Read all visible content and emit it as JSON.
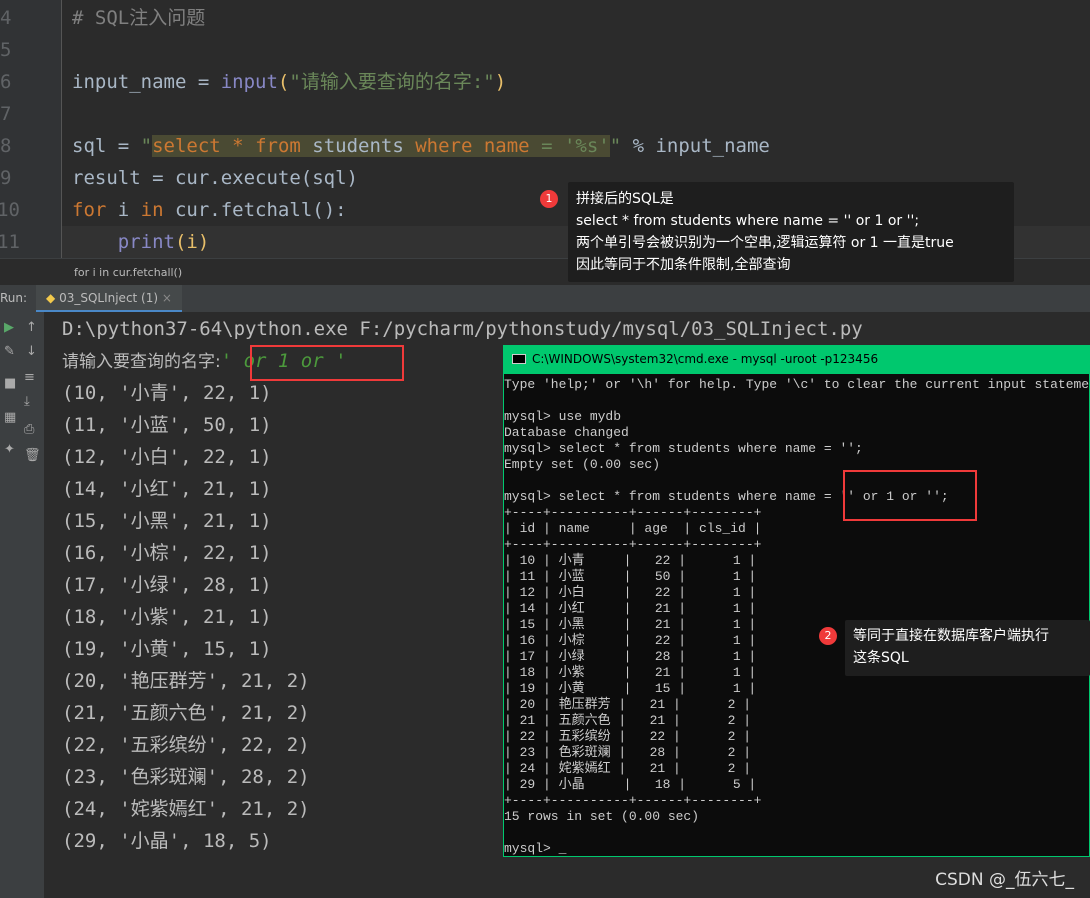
{
  "editor": {
    "line_numbers": [
      "4",
      "5",
      "6",
      "7",
      "8",
      "9",
      "10",
      "11"
    ],
    "comment": "# SQL注入问题",
    "l6": {
      "a": "input_name = ",
      "fn": "input",
      "p1": "(",
      "str": "\"请输入要查询的名字:\"",
      "p2": ")"
    },
    "l8": {
      "a": "sql = ",
      "q": "\"",
      "s1": "select",
      "s2": " * ",
      "s3": "from",
      "s4": " students ",
      "s5": "where",
      "s6": " name",
      "s7": " = '%s'",
      "q2": "\"",
      "b": " % input_name"
    },
    "l9": "result = cur.execute(sql)",
    "l10": {
      "kw1": "for",
      "a": " i ",
      "kw2": "in",
      "b": " cur.fetchall():"
    },
    "l11": {
      "ind": "    ",
      "fn": "print",
      "b": "(i)"
    }
  },
  "breadcrumb": "for i in cur.fetchall()",
  "run": {
    "label": "Run:",
    "tab": "03_SQLInject (1)",
    "close": "×"
  },
  "output": {
    "cmdline": "D:\\python37-64\\python.exe F:/pycharm/pythonstudy/mysql/03_SQLInject.py",
    "prompt": "请输入要查询的名字:",
    "input": "' or 1 or '",
    "rows": [
      "(10, '小青', 22, 1)",
      "(11, '小蓝', 50, 1)",
      "(12, '小白', 22, 1)",
      "(14, '小红', 21, 1)",
      "(15, '小黑', 21, 1)",
      "(16, '小棕', 22, 1)",
      "(17, '小绿', 28, 1)",
      "(18, '小紫', 21, 1)",
      "(19, '小黄', 15, 1)",
      "(20, '艳压群芳', 21, 2)",
      "(21, '五颜六色', 21, 2)",
      "(22, '五彩缤纷', 22, 2)",
      "(23, '色彩斑斓', 28, 2)",
      "(24, '姹紫嫣红', 21, 2)",
      "(29, '小晶', 18, 5)"
    ]
  },
  "cmd": {
    "title": "C:\\WINDOWS\\system32\\cmd.exe - mysql  -uroot -p123456",
    "text": "Type 'help;' or '\\h' for help. Type '\\c' to clear the current input statement.\n\nmysql> use mydb\nDatabase changed\nmysql> select * from students where name = '';\nEmpty set (0.00 sec)\n\nmysql> select * from students where name = '' or 1 or '';\n+----+----------+------+--------+\n| id | name     | age  | cls_id |\n+----+----------+------+--------+\n| 10 | 小青     |   22 |      1 |\n| 11 | 小蓝     |   50 |      1 |\n| 12 | 小白     |   22 |      1 |\n| 14 | 小红     |   21 |      1 |\n| 15 | 小黑     |   21 |      1 |\n| 16 | 小棕     |   22 |      1 |\n| 17 | 小绿     |   28 |      1 |\n| 18 | 小紫     |   21 |      1 |\n| 19 | 小黄     |   15 |      1 |\n| 20 | 艳压群芳 |   21 |      2 |\n| 21 | 五颜六色 |   21 |      2 |\n| 22 | 五彩缤纷 |   22 |      2 |\n| 23 | 色彩斑斓 |   28 |      2 |\n| 24 | 姹紫嫣红 |   21 |      2 |\n| 29 | 小晶     |   18 |      5 |\n+----+----------+------+--------+\n15 rows in set (0.00 sec)\n\nmysql> _"
  },
  "annotations": [
    {
      "num": "1",
      "lines": [
        "拼接后的SQL是",
        "select * from students where name = '' or 1 or '';",
        "两个单引号会被识别为一个空串,逻辑运算符 or 1 一直是true",
        "因此等同于不加条件限制,全部查询"
      ]
    },
    {
      "num": "2",
      "lines": [
        "等同于直接在数据库客户端执行",
        "这条SQL"
      ]
    }
  ],
  "watermark": "CSDN @_伍六七_",
  "colors": {
    "accent_green": "#00c86e",
    "annotation_red": "#f03a3a"
  }
}
